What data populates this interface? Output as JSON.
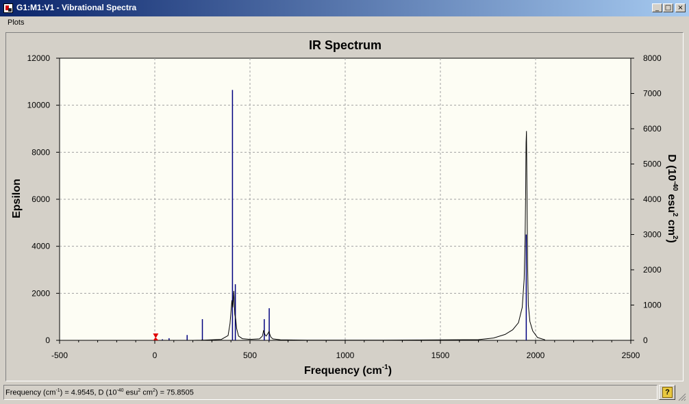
{
  "window": {
    "title": "G1:M1:V1 - Vibrational Spectra",
    "minimize_glyph": "_",
    "maximize_glyph": "□",
    "close_glyph": "×"
  },
  "menu": {
    "items": [
      "Plots"
    ]
  },
  "status": {
    "prefix": "Frequency (cm",
    "unit_sup_1": "-1",
    "mid": ") = 4.9545, D (10",
    "unit_sup_2": "-40",
    "mid2": " esu",
    "unit_sup_3": "2",
    "mid3": " cm",
    "unit_sup_4": "2",
    "suffix": ") = 75.8505"
  },
  "help": {
    "label": "?"
  },
  "colors": {
    "plot_bg": "#fdfdf4",
    "spectrum": "#000000",
    "sticks": "#00007f",
    "marker": "#e00000",
    "frame_bg": "#d4d0c8",
    "titlebar": "#0a246a"
  },
  "chart_data": {
    "type": "line",
    "title": "IR Spectrum",
    "xlabel_main": "Frequency (cm",
    "xlabel_sup": "-1",
    "xlabel_end": ")",
    "ylabel": "Epsilon",
    "y2label_parts": [
      "D (10",
      "-40",
      " esu",
      "2",
      " cm",
      "2",
      ")"
    ],
    "xlim": [
      -500,
      2500
    ],
    "ylim": [
      0,
      12000
    ],
    "y2lim": [
      0,
      8000
    ],
    "xticks": [
      -500,
      0,
      500,
      1000,
      1500,
      2000,
      2500
    ],
    "yticks": [
      0,
      2000,
      4000,
      6000,
      8000,
      10000,
      12000
    ],
    "y2ticks": [
      0,
      1000,
      2000,
      3000,
      4000,
      5000,
      6000,
      7000,
      8000
    ],
    "grid": true,
    "marker_x": 5,
    "series": [
      {
        "kind": "spectrum_epsilon",
        "x": [
          -2,
          200,
          245,
          250,
          255,
          350,
          385,
          395,
          405,
          410,
          415,
          420,
          425,
          430,
          440,
          460,
          500,
          550,
          565,
          572,
          578,
          585,
          595,
          600,
          605,
          610,
          620,
          660,
          800,
          1200,
          1700,
          1780,
          1840,
          1880,
          1910,
          1930,
          1940,
          1945,
          1948,
          1950,
          1952,
          1955,
          1958,
          1962,
          1970,
          1985,
          2010,
          2050
        ],
        "y": [
          0,
          0,
          10,
          20,
          10,
          40,
          200,
          700,
          1700,
          1400,
          2100,
          1100,
          900,
          500,
          180,
          70,
          40,
          60,
          180,
          430,
          250,
          180,
          300,
          380,
          230,
          130,
          60,
          20,
          5,
          5,
          30,
          100,
          250,
          450,
          750,
          1400,
          2600,
          4300,
          6300,
          8400,
          8900,
          6100,
          3300,
          1500,
          800,
          400,
          120,
          20
        ]
      },
      {
        "kind": "sticks_D",
        "x": [
          40,
          75,
          170,
          250,
          408,
          423,
          575,
          601,
          1951
        ],
        "y": [
          30,
          60,
          150,
          600,
          7100,
          1590,
          600,
          910,
          3000
        ]
      }
    ]
  }
}
